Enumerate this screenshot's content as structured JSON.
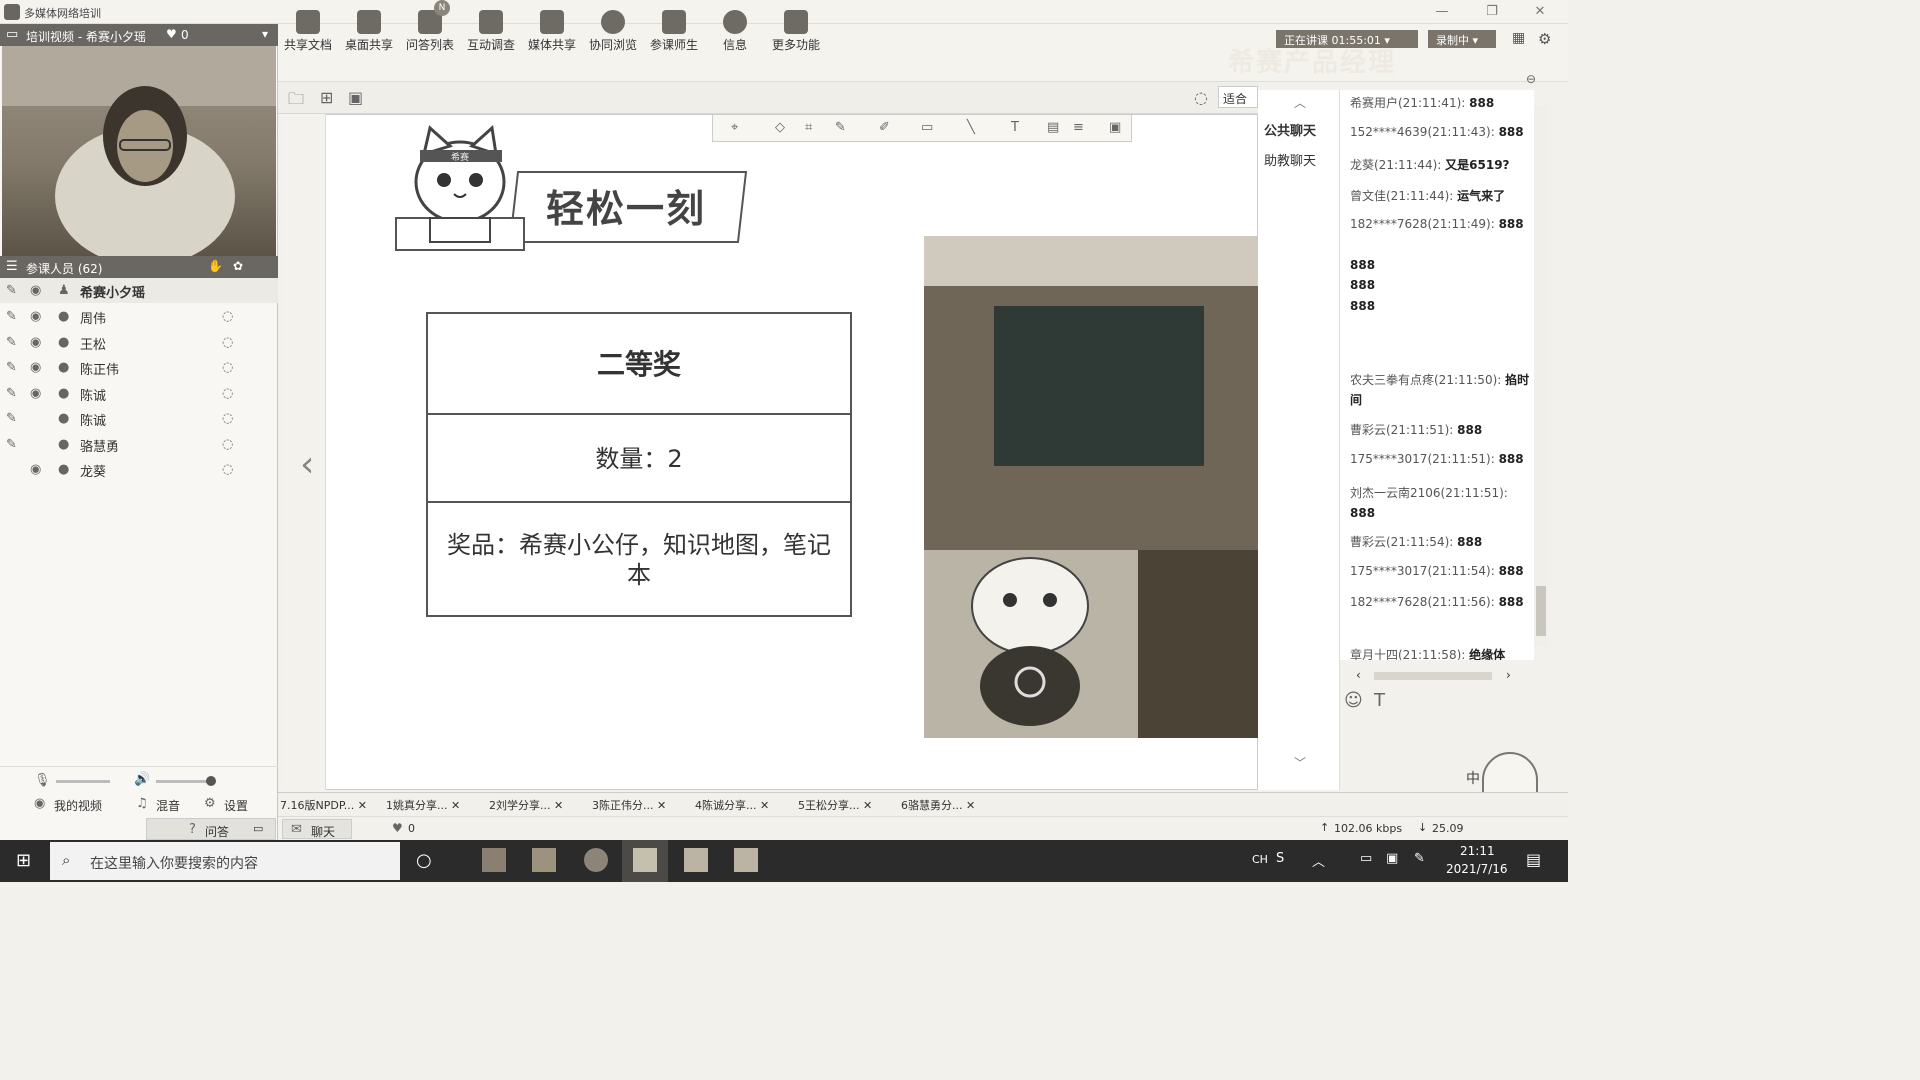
{
  "window": {
    "title": "多媒体网络培训"
  },
  "video_panel": {
    "title": "培训视频 - 希赛小夕瑶",
    "likes": "0"
  },
  "participants": {
    "header": "参课人员 (62)",
    "host": "希赛小夕瑶",
    "list": [
      "周伟",
      "王松",
      "陈正伟",
      "陈诚",
      "陈诚",
      "骆慧勇",
      "龙葵"
    ]
  },
  "left_bottom": {
    "my_video": "我的视频",
    "mix": "混音",
    "settings": "设置",
    "qa": "问答"
  },
  "toolbar": {
    "items": [
      "共享文档",
      "桌面共享",
      "问答列表",
      "互动调查",
      "媒体共享",
      "协同浏览",
      "参课师生",
      "信息",
      "更多功能"
    ],
    "badge": "N"
  },
  "top_right": {
    "status": "正在讲课 01:55:01",
    "record": "录制中",
    "watermark": "希赛产品经理",
    "fit": "适合"
  },
  "slide": {
    "heading": "轻松一刻",
    "mascot_band": "希赛",
    "prize_title": "二等奖",
    "quantity": "数量：2",
    "prize": "奖品：希赛小公仔，知识地图，笔记本"
  },
  "chat_nav": {
    "public": "公共聊天",
    "assistant": "助教聊天"
  },
  "chat": [
    {
      "user": "希赛用户(21:11:41):",
      "text": "888"
    },
    {
      "user": "152****4639(21:11:43):",
      "text": "888"
    },
    {
      "user": "龙葵(21:11:44):",
      "text": "又是6519?"
    },
    {
      "user": "曾文佳(21:11:44):",
      "text": "运气来了"
    },
    {
      "user": "182****7628(21:11:49):",
      "text": "888"
    },
    {
      "user": "",
      "text": "888"
    },
    {
      "user": "",
      "text": "888"
    },
    {
      "user": "",
      "text": "888"
    },
    {
      "user": "农夫三拳有点疼(21:11:50):",
      "text": "掐时间"
    },
    {
      "user": "曹彩云(21:11:51):",
      "text": "888"
    },
    {
      "user": "175****3017(21:11:51):",
      "text": "888"
    },
    {
      "user": "刘杰一云南2106(21:11:51):",
      "text": "888"
    },
    {
      "user": "曹彩云(21:11:54):",
      "text": "888"
    },
    {
      "user": "175****3017(21:11:54):",
      "text": "888"
    },
    {
      "user": "182****7628(21:11:56):",
      "text": "888"
    },
    {
      "user": "章月十四(21:11:58):",
      "text": "绝缘体"
    }
  ],
  "doc_tabs": [
    "7.16版NPDP...",
    "1姚真分享...",
    "2刘学分享...",
    "3陈正伟分...",
    "4陈诚分享...",
    "5王松分享...",
    "6骆慧勇分..."
  ],
  "status_bar": {
    "chat": "聊天",
    "likes": "0",
    "up": "102.06 kbps",
    "down": "25.09"
  },
  "taskbar": {
    "search_placeholder": "在这里输入你要搜索的内容",
    "lang": "CH",
    "time": "21:11",
    "date": "2021/7/16",
    "ime": "中"
  }
}
